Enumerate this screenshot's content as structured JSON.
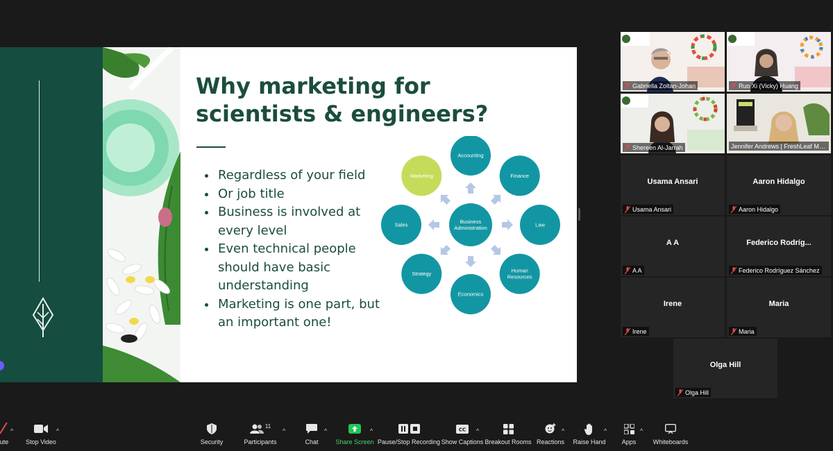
{
  "slide": {
    "title_line1": "Why marketing for",
    "title_line2": "scientists & engineers?",
    "bullets": [
      "Regardless of your field",
      "Or job title",
      "Business is involved at every level",
      "Even technical people should have basic understanding",
      "Marketing is one part, but an important one!"
    ],
    "diagram": {
      "center": [
        "Business",
        "Administration"
      ],
      "nodes": [
        "Accounting",
        "Finance",
        "Law",
        "Human Resources",
        "Economics",
        "Strategy",
        "Sales",
        "Marketing"
      ],
      "highlight": "Marketing",
      "node_color": "#1396a3",
      "highlight_color": "#c5dc5a"
    },
    "colors": {
      "dark_green": "#154d40",
      "title_color": "#1b4d3e"
    }
  },
  "participants": {
    "video": [
      {
        "name": "Gabriella Zoltan-Johan"
      },
      {
        "name": "Ruo Xi (Vicky) Huang"
      },
      {
        "name": "Shereen Al-Jarrah"
      },
      {
        "name": "Jennifer Andrews | FreshLeaf Marke..."
      }
    ],
    "tiles": [
      {
        "center": "Usama Ansari",
        "label": "Usama Ansari"
      },
      {
        "center": "Aaron Hidalgo",
        "label": "Aaron Hidalgo"
      },
      {
        "center": "A A",
        "label": "A A"
      },
      {
        "center": "Federico  Rodríg...",
        "label": "Federico Rodríguez Sánchez"
      },
      {
        "center": "Irene",
        "label": "Irene"
      },
      {
        "center": "Maria",
        "label": "Maria"
      },
      {
        "center": "Olga Hill",
        "label": "Olga Hill"
      }
    ]
  },
  "toolbar": {
    "unmute": "ute",
    "stop_video": "Stop Video",
    "security": "Security",
    "participants": "Participants",
    "participant_count": "11",
    "chat": "Chat",
    "share_screen": "Share Screen",
    "recording": "Pause/Stop Recording",
    "captions": "Show Captions",
    "breakout": "Breakout Rooms",
    "reactions": "Reactions",
    "raise_hand": "Raise Hand",
    "apps": "Apps",
    "whiteboards": "Whiteboards"
  }
}
